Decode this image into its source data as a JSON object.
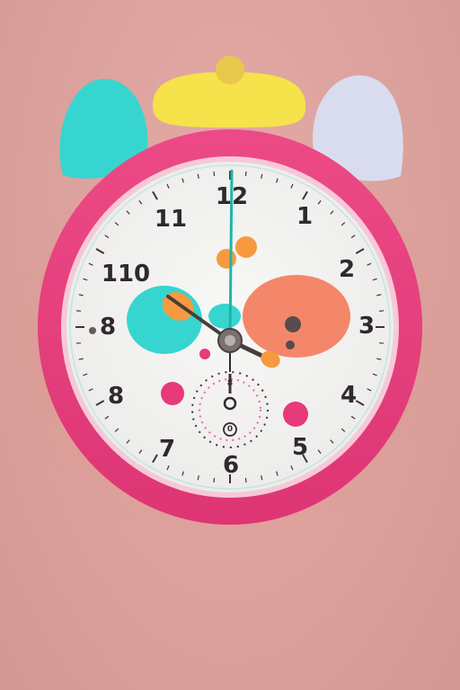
{
  "clock": {
    "numerals": [
      {
        "key": "n12",
        "text": "12"
      },
      {
        "key": "n1",
        "text": "1"
      },
      {
        "key": "n2",
        "text": "2"
      },
      {
        "key": "n3",
        "text": "3"
      },
      {
        "key": "n4",
        "text": "4"
      },
      {
        "key": "n5",
        "text": "5"
      },
      {
        "key": "n6",
        "text": "6"
      },
      {
        "key": "n7",
        "text": "7"
      },
      {
        "key": "n8a",
        "text": "8"
      },
      {
        "key": "n8b",
        "text": "8"
      },
      {
        "key": "n10",
        "text": "110"
      },
      {
        "key": "n11",
        "text": "11"
      }
    ],
    "subdial": {
      "top": "8",
      "bottom": "0"
    }
  },
  "colors": {
    "wall": "#dda39f",
    "ring": "#e8407e",
    "face": "#f3f3f1",
    "teal": "#37d5d0",
    "coral": "#f4876a",
    "orange": "#f79a3f",
    "yellow": "#f6e24a",
    "lavender": "#d9dcef",
    "pink_dot": "#e8397a",
    "hand": "#4a3c3c",
    "second_hand": "#1fb5a8"
  }
}
